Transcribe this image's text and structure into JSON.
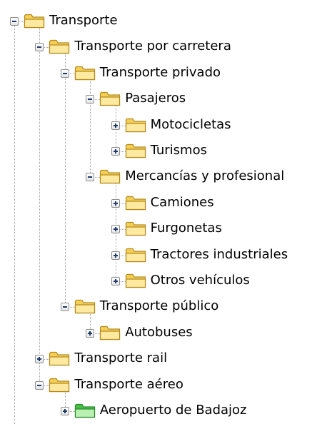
{
  "tree": {
    "items": [
      {
        "label": "Transporte",
        "depth": 0,
        "state": "expanded",
        "icon": "folder-icon"
      },
      {
        "label": "Transporte por carretera",
        "depth": 1,
        "state": "expanded",
        "icon": "folder-icon"
      },
      {
        "label": "Transporte privado",
        "depth": 2,
        "state": "expanded",
        "icon": "folder-icon"
      },
      {
        "label": "Pasajeros",
        "depth": 3,
        "state": "expanded",
        "icon": "folder-icon"
      },
      {
        "label": "Motocicletas",
        "depth": 4,
        "state": "collapsed",
        "icon": "folder-icon"
      },
      {
        "label": "Turismos",
        "depth": 4,
        "state": "collapsed",
        "icon": "folder-icon"
      },
      {
        "label": "Mercancías y profesional",
        "depth": 3,
        "state": "expanded",
        "icon": "folder-icon"
      },
      {
        "label": "Camiones",
        "depth": 4,
        "state": "collapsed",
        "icon": "folder-icon"
      },
      {
        "label": "Furgonetas",
        "depth": 4,
        "state": "collapsed",
        "icon": "folder-icon"
      },
      {
        "label": "Tractores industriales",
        "depth": 4,
        "state": "collapsed",
        "icon": "folder-icon"
      },
      {
        "label": "Otros vehículos",
        "depth": 4,
        "state": "collapsed",
        "icon": "folder-icon"
      },
      {
        "label": "Transporte público",
        "depth": 2,
        "state": "expanded",
        "icon": "folder-icon"
      },
      {
        "label": "Autobuses",
        "depth": 3,
        "state": "collapsed",
        "icon": "folder-icon"
      },
      {
        "label": "Transporte rail",
        "depth": 1,
        "state": "collapsed",
        "icon": "folder-icon"
      },
      {
        "label": "Transporte aéreo",
        "depth": 1,
        "state": "expanded",
        "icon": "folder-icon"
      },
      {
        "label": "Aeropuerto de Badajoz",
        "depth": 2,
        "state": "collapsed",
        "icon": "green-folder-icon"
      }
    ]
  },
  "colors": {
    "folder_body": "#f3cf55",
    "folder_front": "#fde9a0",
    "folder_outline": "#b58a1e",
    "green_folder_body": "#43c043",
    "green_folder_front": "#b9f0b0",
    "green_folder_outline": "#2b8a2b",
    "tree_line": "#a0a0a0"
  }
}
